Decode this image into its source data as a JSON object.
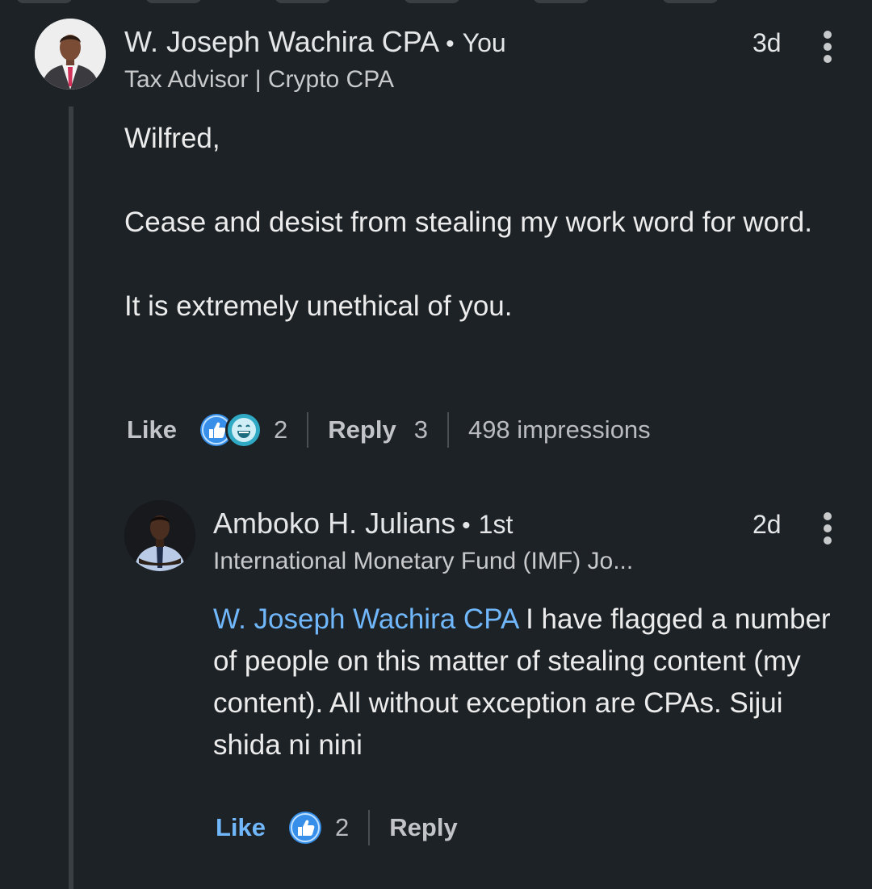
{
  "comment": {
    "author": {
      "name": "W. Joseph Wachira CPA",
      "separator": "•",
      "relation": "You"
    },
    "headline": "Tax Advisor | Crypto CPA",
    "time": "3d",
    "paragraphs": [
      "Wilfred,",
      "Cease and desist from stealing my work word for word.",
      "It is extremely unethical of you."
    ],
    "actions": {
      "like_label": "Like",
      "reactions": [
        "like-reaction-icon",
        "funny-reaction-icon"
      ],
      "reaction_count": "2",
      "reply_label": "Reply",
      "reply_count": "3",
      "impressions": "498 impressions"
    }
  },
  "reply": {
    "author": {
      "name": "Amboko H. Julians",
      "separator": "•",
      "degree": "1st"
    },
    "headline": "International Monetary Fund (IMF) Jo...",
    "time": "2d",
    "mention": "W. Joseph Wachira CPA",
    "text": " I have flagged a number of people on this matter of stealing content (my content). All without exception are CPAs. Sijui shida ni nini",
    "actions": {
      "like_label": "Like",
      "liked": true,
      "reactions": [
        "like-reaction-icon"
      ],
      "reaction_count": "2",
      "reply_label": "Reply"
    }
  },
  "colors": {
    "background": "#1d2226",
    "mention": "#71b7fb",
    "like_active": "#71b7fb",
    "thread_line": "#3a3f44"
  }
}
